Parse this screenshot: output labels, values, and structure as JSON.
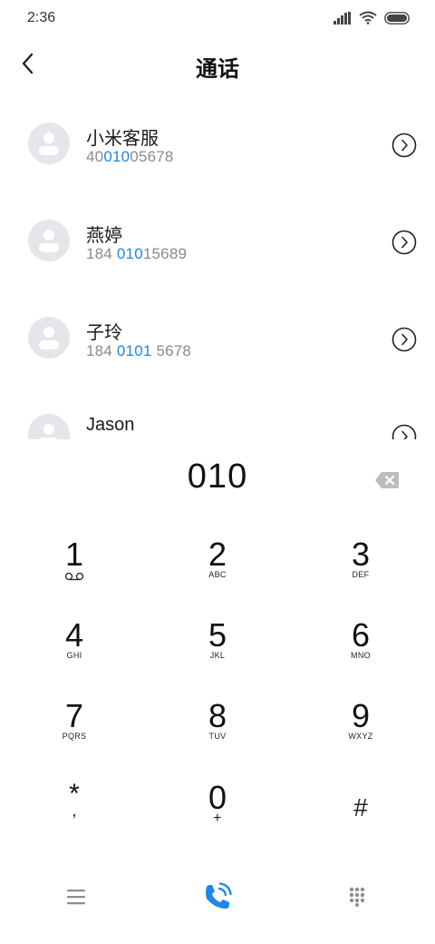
{
  "status": {
    "time": "2:36",
    "signal_icon": "signal-icon",
    "wifi_icon": "wifi-icon",
    "battery_icon": "battery-icon"
  },
  "header": {
    "title": "通话",
    "back_icon": "chevron-left-icon"
  },
  "contacts": [
    {
      "name": "小米客服",
      "number_pre": "40",
      "number_hl": "010",
      "number_post": "05678"
    },
    {
      "name": "燕婷",
      "number_pre": "184 ",
      "number_hl": "010",
      "number_post": "15689"
    },
    {
      "name": "子玲",
      "number_pre": "184 ",
      "number_hl": "0101",
      "number_post": " 5678"
    },
    {
      "name": "Jason",
      "number_pre": "",
      "number_hl": "",
      "number_post": ""
    }
  ],
  "dialer": {
    "number": "010",
    "delete_icon": "backspace-icon"
  },
  "keypad": [
    {
      "digit": "1",
      "letters": ""
    },
    {
      "digit": "2",
      "letters": "ABC"
    },
    {
      "digit": "3",
      "letters": "DEF"
    },
    {
      "digit": "4",
      "letters": "GHI"
    },
    {
      "digit": "5",
      "letters": "JKL"
    },
    {
      "digit": "6",
      "letters": "MNO"
    },
    {
      "digit": "7",
      "letters": "PQRS"
    },
    {
      "digit": "8",
      "letters": "TUV"
    },
    {
      "digit": "9",
      "letters": "WXYZ"
    },
    {
      "digit": "*",
      "letters": ","
    },
    {
      "digit": "0",
      "letters": "+"
    },
    {
      "digit": "#",
      "letters": ""
    }
  ],
  "bottom_nav": {
    "menu_icon": "menu-icon",
    "call_icon": "phone-call-icon",
    "keypad_icon": "dialpad-icon"
  },
  "colors": {
    "accent": "#1e88e5",
    "text": "#1a1a1a",
    "secondary": "#8a8a8a",
    "avatar_bg": "#e4e6ea"
  }
}
